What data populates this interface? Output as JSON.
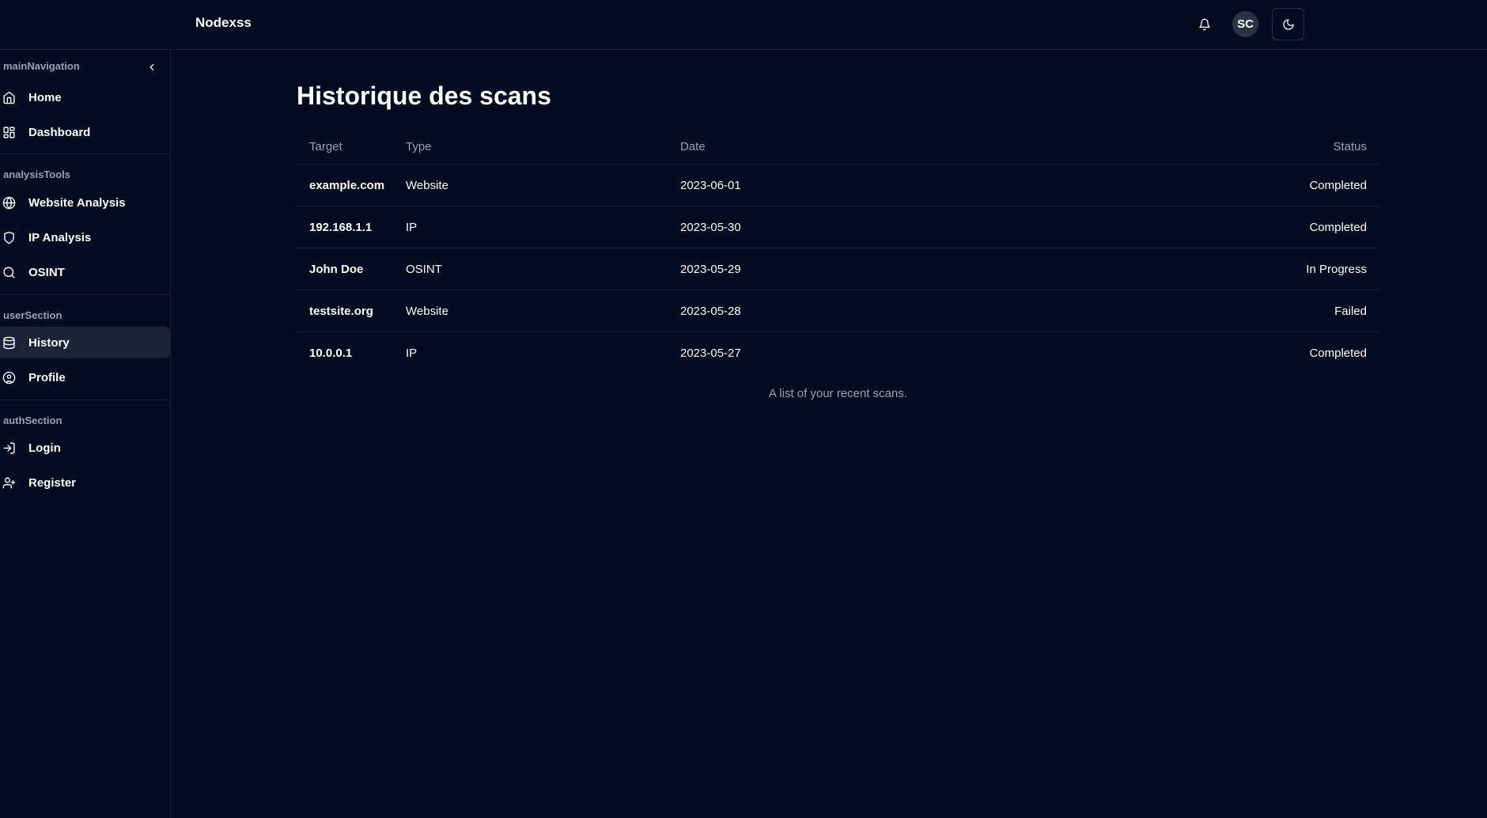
{
  "app": {
    "brand": "Nodexss"
  },
  "header": {
    "avatar_initials": "SC",
    "icons": {
      "notifications": "bell-icon",
      "theme": "moon-icon"
    }
  },
  "sidebar": {
    "sections": [
      {
        "title": "mainNavigation",
        "items": [
          {
            "label": "Home",
            "icon": "home-icon"
          },
          {
            "label": "Dashboard",
            "icon": "dashboard-icon"
          }
        ]
      },
      {
        "title": "analysisTools",
        "items": [
          {
            "label": "Website Analysis",
            "icon": "globe-icon"
          },
          {
            "label": "IP Analysis",
            "icon": "shield-icon"
          },
          {
            "label": "OSINT",
            "icon": "search-icon"
          }
        ]
      },
      {
        "title": "userSection",
        "items": [
          {
            "label": "History",
            "icon": "database-icon",
            "active": true
          },
          {
            "label": "Profile",
            "icon": "user-circle-icon"
          }
        ]
      },
      {
        "title": "authSection",
        "items": [
          {
            "label": "Login",
            "icon": "login-icon"
          },
          {
            "label": "Register",
            "icon": "user-plus-icon"
          }
        ]
      }
    ]
  },
  "main": {
    "title": "Historique des scans",
    "table": {
      "columns": [
        "Target",
        "Type",
        "Date",
        "Status"
      ],
      "rows": [
        {
          "target": "example.com",
          "type": "Website",
          "date": "2023-06-01",
          "status": "Completed"
        },
        {
          "target": "192.168.1.1",
          "type": "IP",
          "date": "2023-05-30",
          "status": "Completed"
        },
        {
          "target": "John Doe",
          "type": "OSINT",
          "date": "2023-05-29",
          "status": "In Progress"
        },
        {
          "target": "testsite.org",
          "type": "Website",
          "date": "2023-05-28",
          "status": "Failed"
        },
        {
          "target": "10.0.0.1",
          "type": "IP",
          "date": "2023-05-27",
          "status": "Completed"
        }
      ],
      "caption": "A list of your recent scans."
    }
  },
  "colors": {
    "background": "#020b1f",
    "border": "#1b2437",
    "muted_text": "#94a3b8",
    "active_bg": "#1b2437"
  }
}
